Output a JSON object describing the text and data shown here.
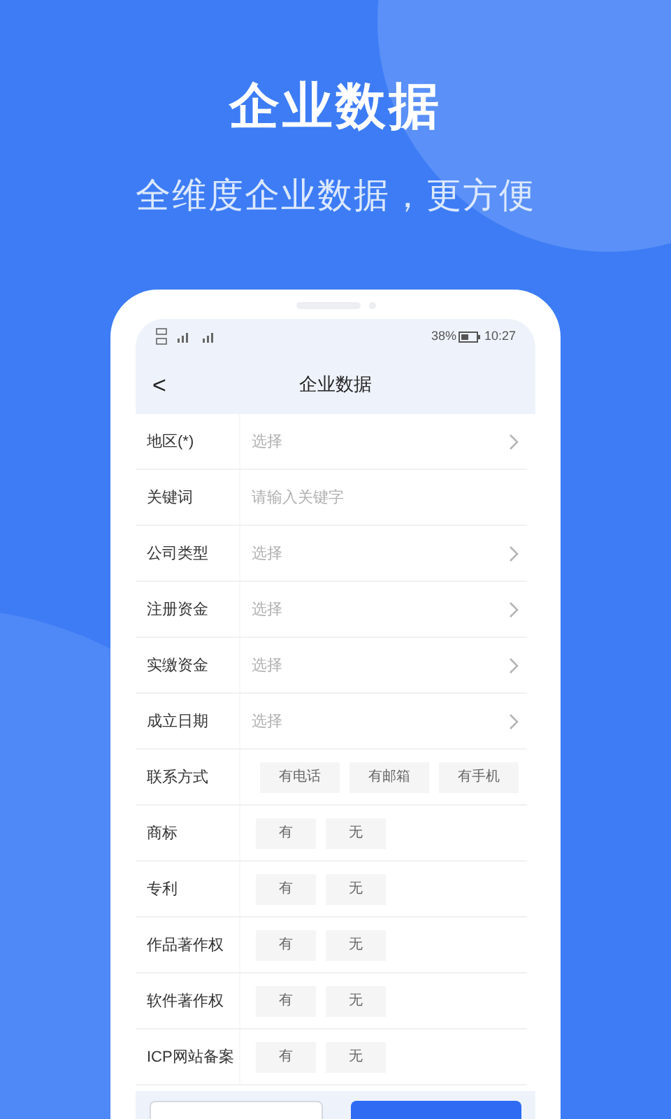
{
  "promo": {
    "title": "企业数据",
    "subtitle": "全维度企业数据，更方便"
  },
  "status_bar": {
    "battery": "38%",
    "time": "10:27"
  },
  "nav": {
    "back": "<",
    "title": "企业数据"
  },
  "rows": [
    {
      "kind": "select",
      "label": "地区(*)",
      "placeholder": "选择"
    },
    {
      "kind": "input",
      "label": "关键词",
      "placeholder": "请输入关键字"
    },
    {
      "kind": "select",
      "label": "公司类型",
      "placeholder": "选择"
    },
    {
      "kind": "select",
      "label": "注册资金",
      "placeholder": "选择"
    },
    {
      "kind": "select",
      "label": "实缴资金",
      "placeholder": "选择"
    },
    {
      "kind": "select",
      "label": "成立日期",
      "placeholder": "选择"
    },
    {
      "kind": "wide_options",
      "label": "联系方式",
      "options": [
        "有电话",
        "有邮箱",
        "有手机"
      ]
    },
    {
      "kind": "options",
      "label": "商标",
      "options": [
        "有",
        "无"
      ]
    },
    {
      "kind": "options",
      "label": "专利",
      "options": [
        "有",
        "无"
      ]
    },
    {
      "kind": "options",
      "label": "作品著作权",
      "options": [
        "有",
        "无"
      ]
    },
    {
      "kind": "options",
      "label": "软件著作权",
      "options": [
        "有",
        "无"
      ]
    },
    {
      "kind": "options",
      "label": "ICP网站备案",
      "options": [
        "有",
        "无"
      ]
    }
  ]
}
